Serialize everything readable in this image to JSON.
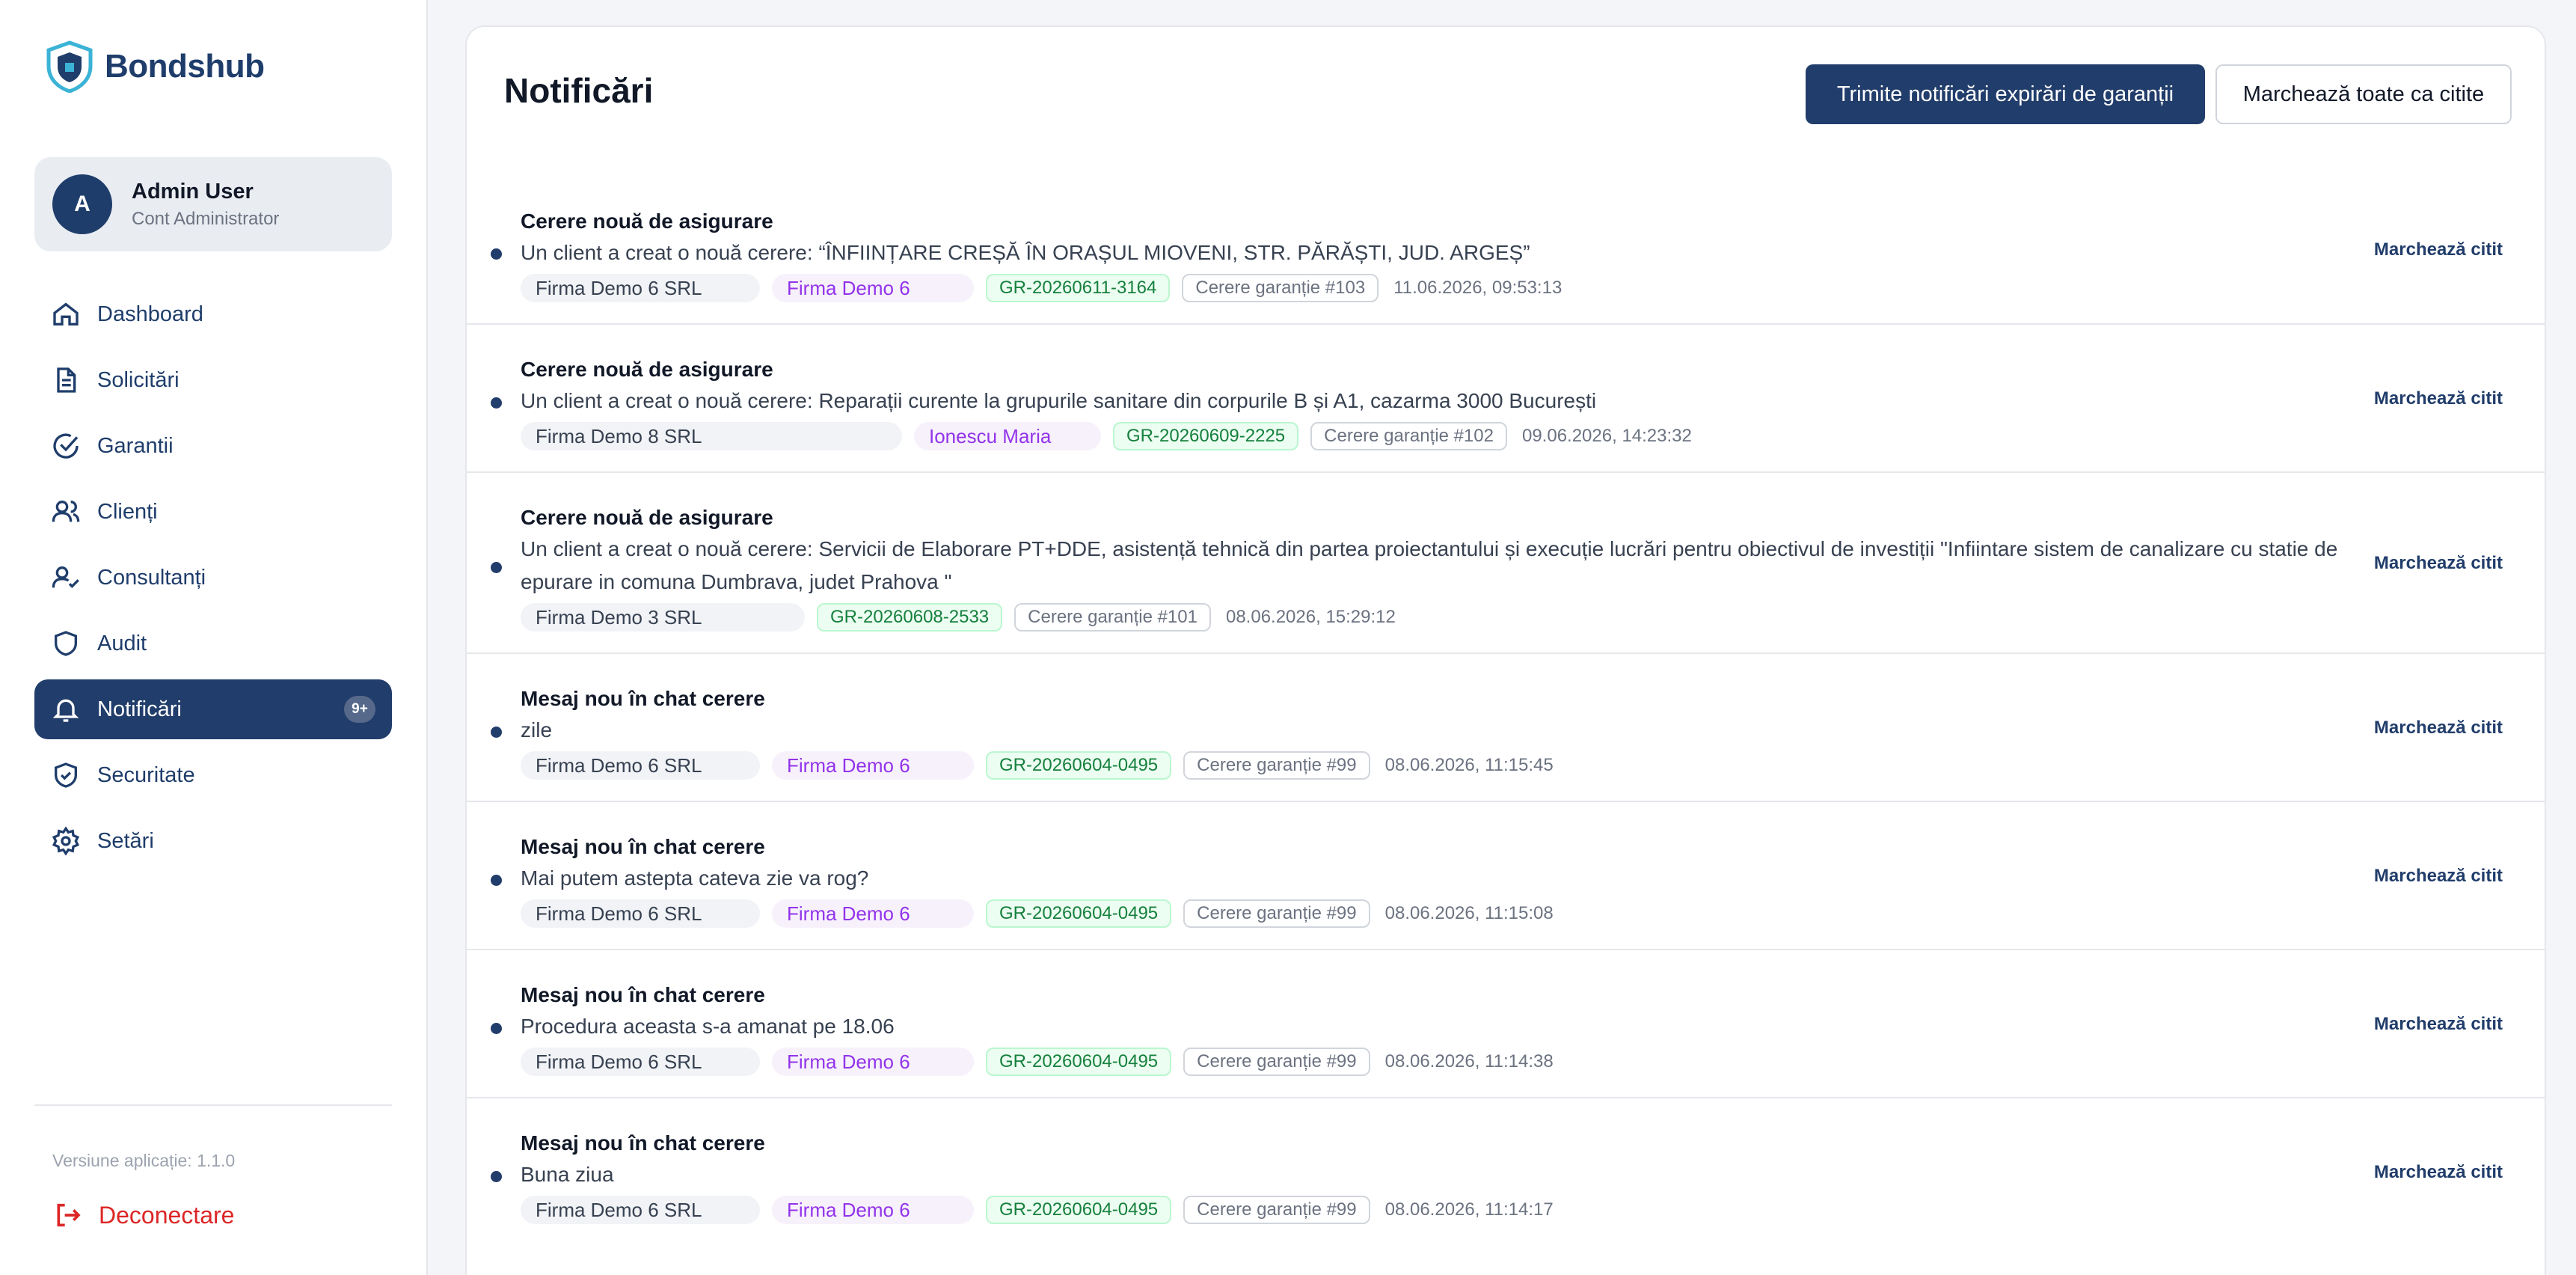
{
  "app": {
    "name": "Bondshub"
  },
  "user": {
    "initial": "A",
    "name": "Admin User",
    "role": "Cont Administrator"
  },
  "nav": {
    "items": [
      {
        "label": "Dashboard",
        "icon": "home-icon"
      },
      {
        "label": "Solicitări",
        "icon": "document-icon"
      },
      {
        "label": "Garantii",
        "icon": "check-circle-icon"
      },
      {
        "label": "Clienți",
        "icon": "users-icon"
      },
      {
        "label": "Consultanți",
        "icon": "user-check-icon"
      },
      {
        "label": "Audit",
        "icon": "shield-icon"
      },
      {
        "label": "Notificări",
        "icon": "bell-icon",
        "badge": "9+",
        "active": true
      },
      {
        "label": "Securitate",
        "icon": "shield-check-icon"
      },
      {
        "label": "Setări",
        "icon": "gear-icon"
      }
    ]
  },
  "footer": {
    "version": "Versiune aplicație: 1.1.0",
    "logout": "Deconectare"
  },
  "page": {
    "title": "Notificări",
    "primary_button": "Trimite notificări expirări de garanții",
    "secondary_button": "Marchează toate ca citite",
    "mark_read_label": "Marchează citit"
  },
  "colors": {
    "primary": "#213d6b",
    "danger": "#dc2626",
    "client_tag": "#9333ea",
    "code_tag": "#15803d"
  },
  "notifications": [
    {
      "title": "Cerere nouă de asigurare",
      "body": "Un client a creat o nouă cerere: “ÎNFIINȚARE CREȘĂ ÎN ORAȘUL MIOVENI, STR. PĂRĂȘTI, JUD. ARGEȘ”",
      "firm": "Firma Demo 6 SRL",
      "client": "Firma Demo 6",
      "code": "GR-20260611-3164",
      "request": "Cerere garanție #103",
      "time": "11.06.2026, 09:53:13"
    },
    {
      "title": "Cerere nouă de asigurare",
      "body": "Un client a creat o nouă cerere: Reparații curente la grupurile sanitare din corpurile B și A1, cazarma 3000 București",
      "firm": "Firma Demo 8 SRL",
      "client": "Ionescu Maria",
      "code": "GR-20260609-2225",
      "request": "Cerere garanție #102",
      "time": "09.06.2026, 14:23:32"
    },
    {
      "title": "Cerere nouă de asigurare",
      "body": "Un client a creat o nouă cerere: Servicii de Elaborare PT+DDE, asistență tehnică din partea proiectantului și execuție lucrări pentru obiectivul de investiții \"Infiintare sistem de canalizare cu statie de epurare in comuna Dumbrava, judet Prahova \"",
      "firm": "Firma Demo 3 SRL",
      "client": "",
      "code": "GR-20260608-2533",
      "request": "Cerere garanție #101",
      "time": "08.06.2026, 15:29:12"
    },
    {
      "title": "Mesaj nou în chat cerere",
      "body": "zile",
      "firm": "Firma Demo 6 SRL",
      "client": "Firma Demo 6",
      "code": "GR-20260604-0495",
      "request": "Cerere garanție #99",
      "time": "08.06.2026, 11:15:45"
    },
    {
      "title": "Mesaj nou în chat cerere",
      "body": "Mai putem astepta cateva zie va rog?",
      "firm": "Firma Demo 6 SRL",
      "client": "Firma Demo 6",
      "code": "GR-20260604-0495",
      "request": "Cerere garanție #99",
      "time": "08.06.2026, 11:15:08"
    },
    {
      "title": "Mesaj nou în chat cerere",
      "body": "Procedura aceasta s-a amanat pe 18.06",
      "firm": "Firma Demo 6 SRL",
      "client": "Firma Demo 6",
      "code": "GR-20260604-0495",
      "request": "Cerere garanție #99",
      "time": "08.06.2026, 11:14:38"
    },
    {
      "title": "Mesaj nou în chat cerere",
      "body": "Buna ziua",
      "firm": "Firma Demo 6 SRL",
      "client": "Firma Demo 6",
      "code": "GR-20260604-0495",
      "request": "Cerere garanție #99",
      "time": "08.06.2026, 11:14:17"
    }
  ]
}
